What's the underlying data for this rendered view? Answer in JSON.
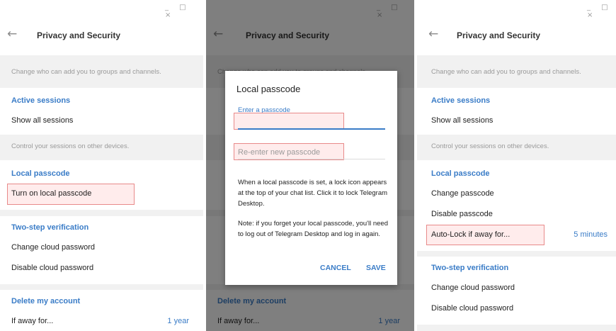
{
  "window": {
    "controls": "_ □ ×"
  },
  "page": {
    "title": "Privacy and Security",
    "back_icon": "←"
  },
  "left": {
    "groups_note": "Change who can add you to groups and channels.",
    "active_sessions": {
      "header": "Active sessions",
      "show_all": "Show all sessions"
    },
    "sessions_note": "Control your sessions on other devices.",
    "local_passcode": {
      "header": "Local passcode",
      "turn_on": "Turn on local passcode"
    },
    "two_step": {
      "header": "Two-step verification",
      "change": "Change cloud password",
      "disable": "Disable cloud password"
    },
    "delete_account": {
      "header": "Delete my account",
      "if_away": "If away for...",
      "value": "1 year"
    }
  },
  "middle": {
    "groups_note_partial": "Change who can add you to groups and channels.",
    "delete_account": {
      "header": "Delete my account",
      "if_away": "If away for...",
      "value": "1 year"
    },
    "dialog": {
      "title": "Local passcode",
      "enter_label": "Enter a passcode",
      "enter_value": "",
      "reenter_placeholder": "Re-enter new passcode",
      "info": "When a local passcode is set, a lock icon appears at the top of your chat list. Click it to lock Telegram Desktop.",
      "warning": "Note: if you forget your local passcode, you'll need to log out of Telegram Desktop and log in again.",
      "cancel": "CANCEL",
      "save": "SAVE"
    }
  },
  "right": {
    "groups_note": "Change who can add you to groups and channels.",
    "active_sessions": {
      "header": "Active sessions",
      "show_all": "Show all sessions"
    },
    "sessions_note": "Control your sessions on other devices.",
    "local_passcode": {
      "header": "Local passcode",
      "change": "Change passcode",
      "disable": "Disable passcode",
      "auto_lock": "Auto-Lock if away for...",
      "auto_lock_value": "5 minutes"
    },
    "two_step": {
      "header": "Two-step verification",
      "change": "Change cloud password",
      "disable": "Disable cloud password"
    }
  }
}
